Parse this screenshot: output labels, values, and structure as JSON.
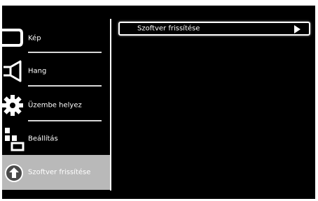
{
  "sidebar": {
    "items": [
      {
        "label": "Kép",
        "icon": "picture-icon"
      },
      {
        "label": "Hang",
        "icon": "speaker-icon"
      },
      {
        "label": "Üzembe helyez",
        "icon": "gear-icon"
      },
      {
        "label": "Beállítás",
        "icon": "settings-grid-icon"
      },
      {
        "label": "Szoftver frissítése",
        "icon": "software-update-icon",
        "selected": true
      }
    ]
  },
  "main": {
    "menu_item": {
      "label": "Szoftver frissítése",
      "arrow_icon": "arrow-right-icon"
    }
  },
  "colors": {
    "background": "#000000",
    "text": "#ffffff",
    "selected_background": "#b9b9b9"
  }
}
